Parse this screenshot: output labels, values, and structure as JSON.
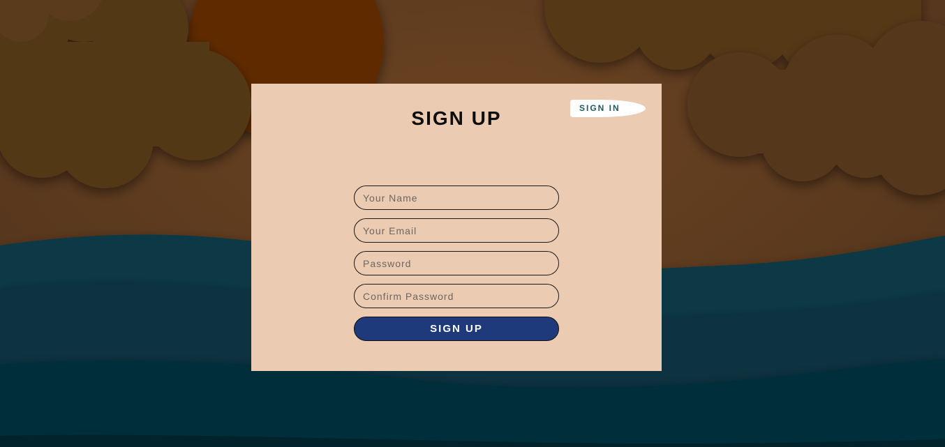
{
  "signup_card": {
    "title": "SIGN UP",
    "signin_link": "SIGN IN",
    "fields": {
      "name_placeholder": "Your Name",
      "email_placeholder": "Your Email",
      "password_placeholder": "Password",
      "confirm_placeholder": "Confirm Password"
    },
    "submit_label": "SIGN UP"
  },
  "colors": {
    "card_background": "#ebcbb2",
    "submit_background": "#1f3a7a",
    "signin_text": "#1c5a5e",
    "sky": "#5e3a1f",
    "sea": "#063240"
  }
}
